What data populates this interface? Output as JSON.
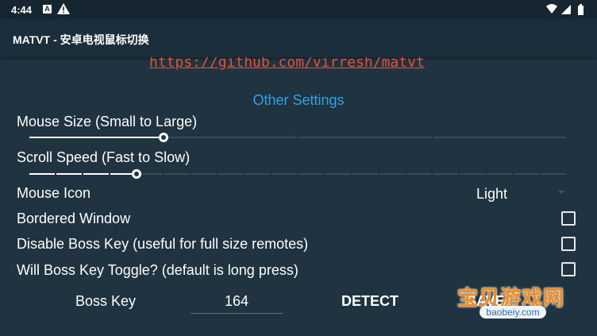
{
  "status_bar": {
    "time": "4:44",
    "notification_icons": [
      "a-notification-icon",
      "alert-icon"
    ],
    "system_icons": [
      "wifi-icon",
      "signal-icon",
      "battery-icon"
    ]
  },
  "app_bar": {
    "title": "MATVT - 安卓电视鼠标切换"
  },
  "content": {
    "link": "https://github.com/virresh/matvt",
    "section_title": "Other Settings",
    "mouse_size": {
      "label": "Mouse Size (Small to Large)",
      "steps": 4,
      "value_fraction": 0.25
    },
    "scroll_speed": {
      "label": "Scroll Speed (Fast to Slow)",
      "steps": 20,
      "value_fraction": 0.2
    },
    "mouse_icon": {
      "label": "Mouse Icon",
      "selected": "Light"
    },
    "bordered_window": {
      "label": "Bordered Window",
      "checked": false
    },
    "disable_boss_key": {
      "label": "Disable Boss Key (useful for full size remotes)",
      "checked": false
    },
    "boss_key_toggle": {
      "label": "Will Boss Key Toggle? (default is long press)",
      "checked": false
    },
    "boss_key": {
      "label": "Boss Key",
      "value": "164",
      "detect_label": "DETECT",
      "save_label": "SAVE"
    }
  },
  "watermark": {
    "text": "宝贝游戏网",
    "domain": "baobeiy.com"
  },
  "colors": {
    "background": "#1f3340",
    "app_bar": "#1a2e3b",
    "link": "#e0533c",
    "section_title": "#2fa3e6",
    "watermark": "#f28a1c"
  }
}
